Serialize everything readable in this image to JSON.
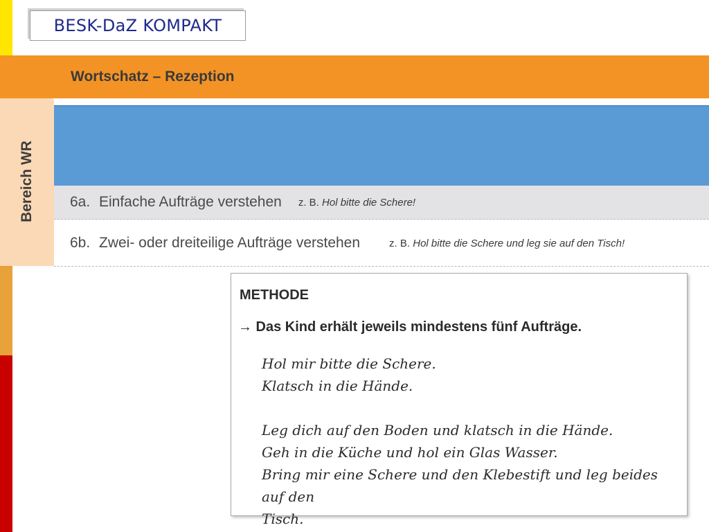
{
  "slide": {
    "title": "BESK-DaZ KOMPAKT",
    "colors": {
      "yellow": "#ffe600",
      "orange": "#f39325",
      "orange_light": "#e8a23a",
      "red": "#c90000",
      "tab": "#fcd9b6",
      "blue": "#5b9bd5",
      "row_gray": "#e3e3e5"
    }
  },
  "header": {
    "title": "Wortschatz – Rezeption"
  },
  "side_tab": {
    "label": "Bereich WR"
  },
  "items": [
    {
      "number": "6a.",
      "text": "Einfache Aufträge verstehen",
      "example_prefix": "z. B.",
      "example": "Hol bitte die Schere!"
    },
    {
      "number": "6b.",
      "text": "Zwei- oder dreiteilige Aufträge verstehen",
      "example_prefix": "z. B.",
      "example": "Hol bitte die Schere und leg sie auf den Tisch!"
    }
  ],
  "methode": {
    "heading": "METHODE",
    "instruction": "→ Das Kind erhält jeweils mindestens fünf Aufträge.",
    "group1": [
      "Hol mir bitte die Schere.",
      "Klatsch in die Hände."
    ],
    "group2": [
      "Leg dich auf den Boden und klatsch in die Hände.",
      "Geh in die Küche und hol ein Glas Wasser.",
      "Bring mir eine Schere und den Klebestift und leg beides auf den",
      "Tisch."
    ]
  }
}
